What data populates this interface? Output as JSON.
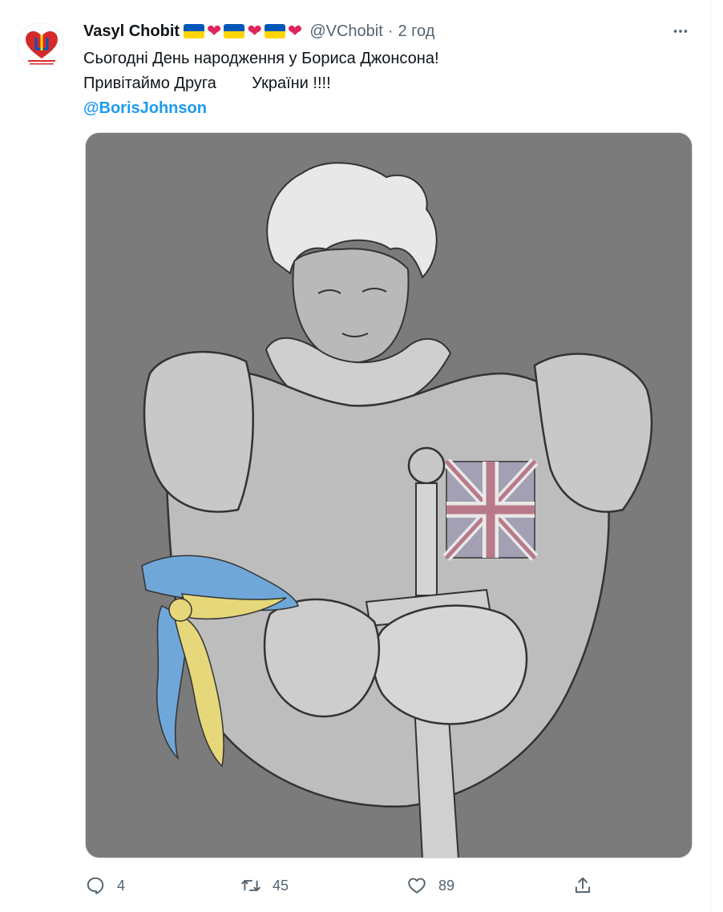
{
  "tweet": {
    "author": {
      "display_name": "Vasyl Chobit",
      "handle": "@VChobit",
      "avatar_text": "ПИШАЮСЯ АРМІЄЮ! ЛЮБЛЮ УКРАЇНУ!"
    },
    "separator": "·",
    "timestamp": "2 год",
    "more_label": "•••",
    "text_lines": [
      "Сьогодні День народження у Бориса Джонсона!",
      "Привітаймо Друга        України !!!!"
    ],
    "mention": "@BorisJohnson",
    "badges": [
      "ukraine-flag-icon",
      "red-heart-icon",
      "ukraine-flag-icon",
      "red-heart-icon",
      "ukraine-flag-icon",
      "red-heart-icon"
    ],
    "heart_glyph": "❤",
    "actions": {
      "reply_count": "4",
      "retweet_count": "45",
      "like_count": "89"
    },
    "media": {
      "description_icon": "knight-portrait-illustration"
    }
  },
  "colors": {
    "text": "#0f1419",
    "secondary": "#536471",
    "link": "#1d9bf0",
    "flag_blue": "#0057b7",
    "flag_yellow": "#ffd500",
    "heart": "#e0245e"
  }
}
